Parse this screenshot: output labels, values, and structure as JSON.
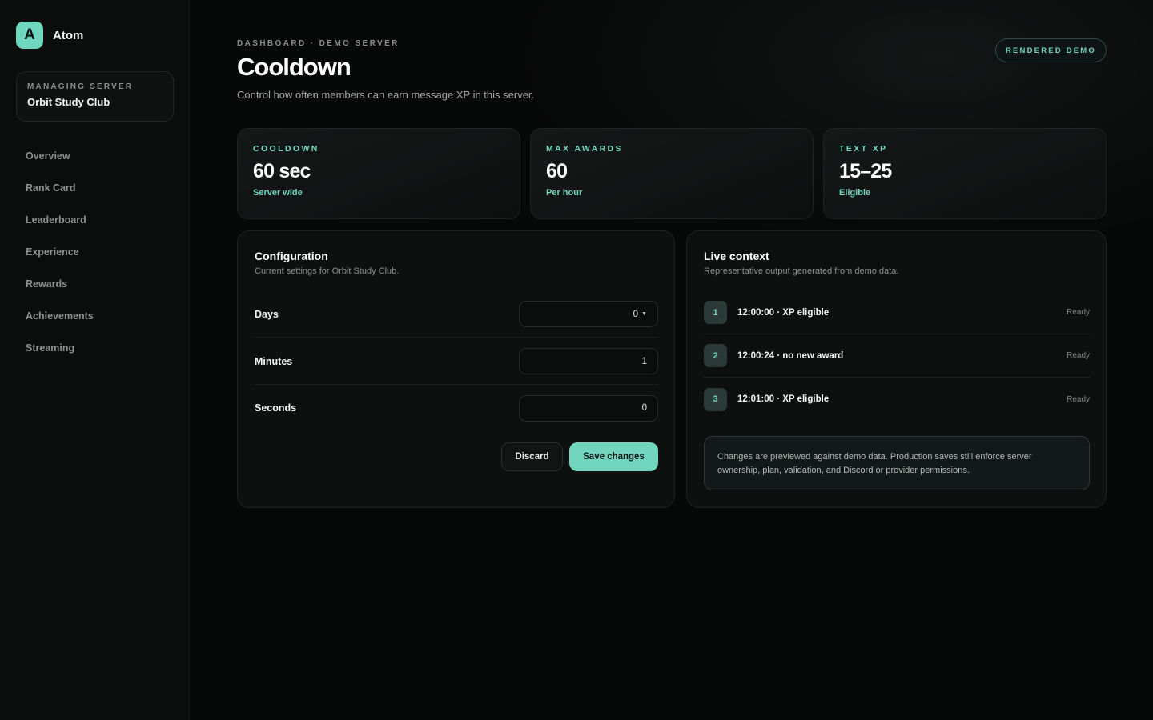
{
  "brand": {
    "logo_letter": "A",
    "name": "Atom"
  },
  "server": {
    "caption": "MANAGING SERVER",
    "name": "Orbit Study Club"
  },
  "nav": {
    "items": [
      {
        "label": "Overview"
      },
      {
        "label": "Rank Card"
      },
      {
        "label": "Leaderboard"
      },
      {
        "label": "Experience"
      },
      {
        "label": "Rewards"
      },
      {
        "label": "Achievements"
      },
      {
        "label": "Streaming"
      }
    ]
  },
  "header": {
    "eyebrow": "DASHBOARD · DEMO SERVER",
    "title": "Cooldown",
    "subtitle": "Control how often members can earn message XP in this server.",
    "badge": "RENDERED DEMO"
  },
  "stats": [
    {
      "label": "COOLDOWN",
      "value": "60 sec",
      "note": "Server wide"
    },
    {
      "label": "MAX AWARDS",
      "value": "60",
      "note": "Per hour"
    },
    {
      "label": "TEXT XP",
      "value": "15–25",
      "note": "Eligible"
    }
  ],
  "config": {
    "title": "Configuration",
    "subtitle": "Current settings for Orbit Study Club.",
    "fields": [
      {
        "label": "Days",
        "value": "0"
      },
      {
        "label": "Minutes",
        "value": "1"
      },
      {
        "label": "Seconds",
        "value": "0"
      }
    ],
    "discard_label": "Discard",
    "save_label": "Save changes"
  },
  "live": {
    "title": "Live context",
    "subtitle": "Representative output generated from demo data.",
    "rows": [
      {
        "step": "1",
        "text": "12:00:00 · XP eligible",
        "status": "Ready"
      },
      {
        "step": "2",
        "text": "12:00:24 · no new award",
        "status": "Ready"
      },
      {
        "step": "3",
        "text": "12:01:00 · XP eligible",
        "status": "Ready"
      }
    ],
    "notice": "Changes are previewed against demo data. Production saves still enforce server ownership, plan, validation, and Discord or provider permissions."
  },
  "colors": {
    "accent": "#72d5be",
    "background": "#070808",
    "sidebar": "#0b0c0c",
    "card": "#0e1010"
  }
}
